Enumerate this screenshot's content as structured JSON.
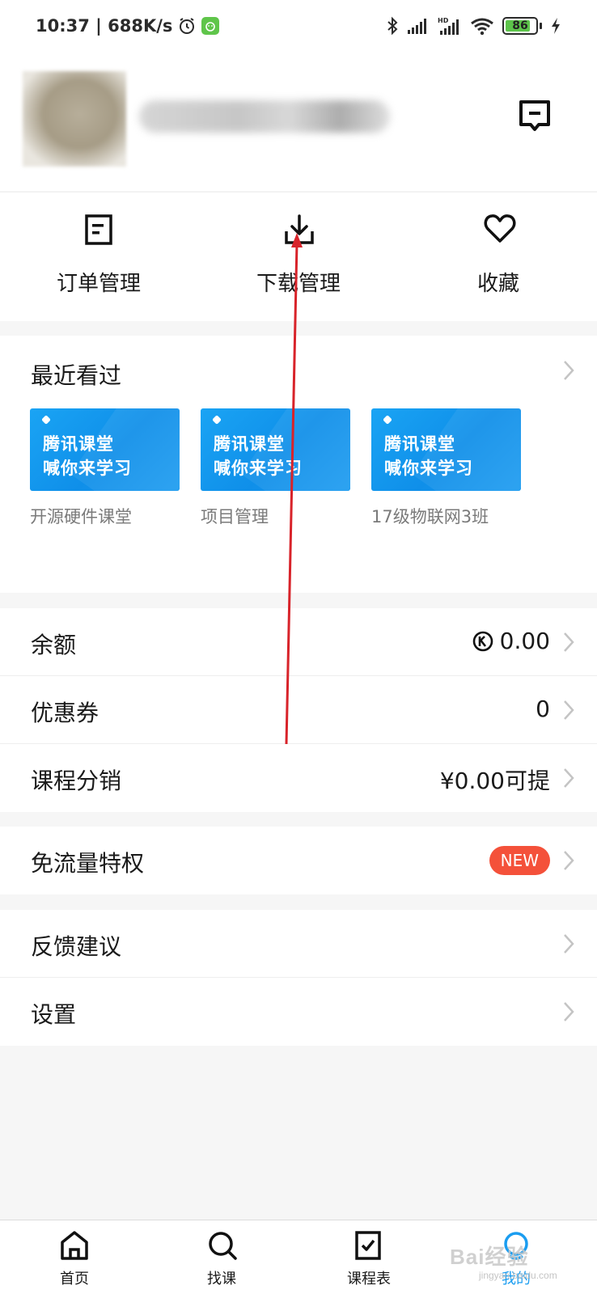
{
  "status_bar": {
    "time_speed": "10:37 | 688K/s",
    "battery": "86",
    "battery_level_percent": 86
  },
  "profile": {
    "avatar_icon": "avatar",
    "message_icon": "message-icon"
  },
  "quick_actions": [
    {
      "label": "订单管理",
      "icon": "order-icon"
    },
    {
      "label": "下载管理",
      "icon": "download-icon"
    },
    {
      "label": "收藏",
      "icon": "heart-icon"
    }
  ],
  "recent": {
    "title": "最近看过",
    "thumb_line1": "腾讯课堂",
    "thumb_line2": "喊你来学习",
    "items": [
      {
        "caption": "开源硬件课堂"
      },
      {
        "caption": "项目管理"
      },
      {
        "caption": "17级物联网3班"
      }
    ]
  },
  "wallet": {
    "balance_label": "余额",
    "balance_value": "0.00",
    "coupon_label": "优惠券",
    "coupon_value": "0",
    "distribution_label": "课程分销",
    "distribution_value": "¥0.00可提"
  },
  "privilege": {
    "label": "免流量特权",
    "badge": "NEW"
  },
  "misc": {
    "feedback_label": "反馈建议",
    "settings_label": "设置"
  },
  "tabbar": [
    {
      "label": "首页",
      "icon": "home-icon"
    },
    {
      "label": "找课",
      "icon": "search-icon"
    },
    {
      "label": "课程表",
      "icon": "schedule-icon"
    },
    {
      "label": "我的",
      "icon": "profile-icon",
      "active": true
    }
  ],
  "watermark": {
    "text": "Bai经验",
    "sub": "jingyan.baidu.com"
  },
  "colors": {
    "accent": "#1b9df0",
    "badge": "#f4513a",
    "annotation_arrow": "#d8232a"
  }
}
